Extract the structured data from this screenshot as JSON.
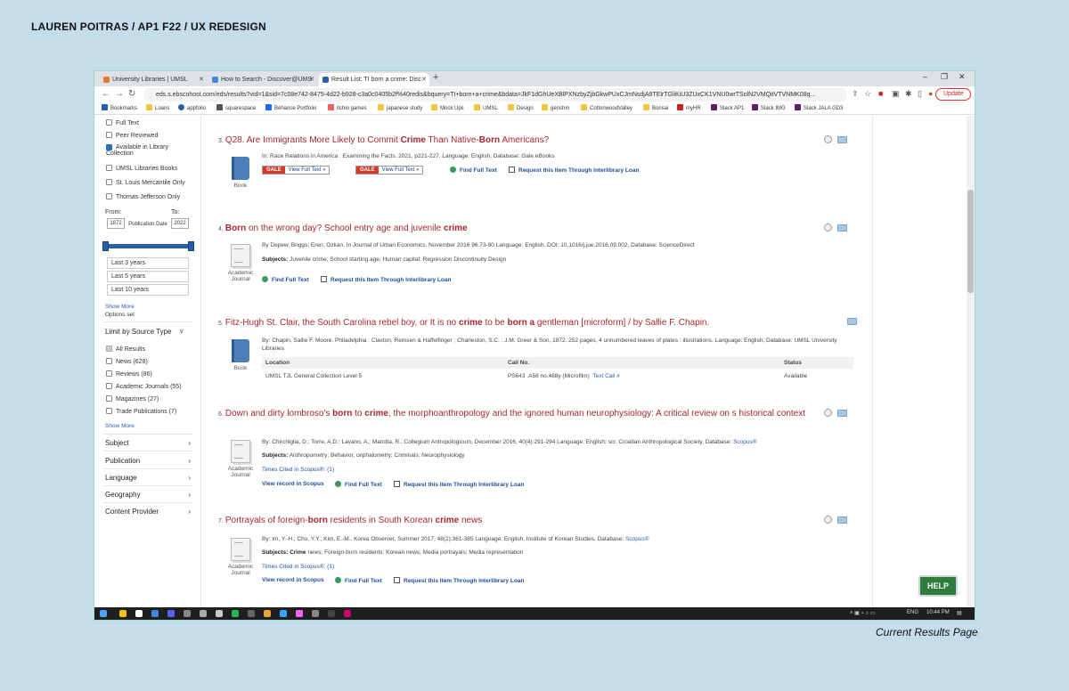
{
  "page": {
    "heading": "LAUREN POITRAS / AP1 F22 / UX REDESIGN",
    "caption": "Current Results Page"
  },
  "browser": {
    "tabs": [
      {
        "label": "University Libraries | UMSL",
        "color": "#e47b2a"
      },
      {
        "label": "How to Search - Discover@UMS",
        "color": "#3b8ad8"
      },
      {
        "label": "Result List: TI born a crime: Disc",
        "color": "#2a5fa8"
      }
    ],
    "url": "eds.s.ebscohost.com/eds/results?vid=1&sid=7c08e742-8475-4d22-b928-c3a0c0405b2f%40redis&bquery=TI+born+a+crime&bdata=JkF1dGhUeXBlPXNzbyZjbGkwPUxCJmNsdjA9TElrTGliKiU3ZUxCK1VNU0wrTSolN2VMQitVTVNMK08q...",
    "update_label": "Update",
    "bookmarks": [
      "Bookmarks",
      "Loans",
      "appfolio",
      "squarespace",
      "Behance Portfolio",
      "itchio games",
      "japanese study",
      "Mock Ups",
      "UMSL",
      "Design",
      "genshin",
      "CottonwoodValley",
      "Bonsai",
      "myHR",
      "Slack AP1",
      "Slack IMG",
      "Slack JALA GD3"
    ]
  },
  "sidebar": {
    "checkboxes": [
      {
        "label": "Full Text",
        "checked": false
      },
      {
        "label": "Peer Reviewed",
        "checked": false
      },
      {
        "label": "Available in Library Collection",
        "checked": true
      },
      {
        "label": "UMSL Libraries Books",
        "checked": false
      },
      {
        "label": "St. Louis Mercantile Only",
        "checked": false
      },
      {
        "label": "Thomas Jefferson Only",
        "checked": false
      }
    ],
    "date": {
      "from_label": "From:",
      "to_label": "To:",
      "from": "1872",
      "to": "2022",
      "label": "Publication Date"
    },
    "ranges": [
      "Last 3 years",
      "Last 5 years",
      "Last 10 years"
    ],
    "show_more": "Show More",
    "options_set": "Options set",
    "source_heading": "Limit by Source Type",
    "sources": [
      {
        "label": "All Results"
      },
      {
        "label": "News (628)"
      },
      {
        "label": "Reviews (86)"
      },
      {
        "label": "Academic Journals (55)"
      },
      {
        "label": "Magazines (27)"
      },
      {
        "label": "Trade Publications (7)"
      }
    ],
    "show_more2": "Show More",
    "sections": [
      "Subject",
      "Publication",
      "Language",
      "Geography",
      "Content Provider"
    ]
  },
  "results": [
    {
      "num": "3.",
      "title_parts": [
        "Q28. Are Immigrants More Likely to Commit ",
        "Crime",
        " Than Native-",
        "Born",
        " Americans?"
      ],
      "meta": "In: Race Relations in America : Examining the Facts. 2021, p221-227. Language: English, Database: Gale eBooks",
      "type": "Book",
      "gale_label": "GALE",
      "gale_view": "View Full Text »",
      "find": "Find Full Text",
      "request": "Request this Item Through Interlibrary Loan"
    },
    {
      "num": "4.",
      "title_parts": [
        "Born",
        " on the wrong day? School entry age and juvenile ",
        "crime"
      ],
      "meta": "By Depew, Briggs; Eren, Ozkan. In Journal of Urban Economics. November 2016 96:73-90 Language: English. DOI: 10.1016/j.jue.2016.09.002, Database: ScienceDirect",
      "subjects_label": "Subjects:",
      "subjects": "Juvenile crime; School starting age; Human capital; Regression Discontinuity Design",
      "type": "Academic Journal",
      "find": "Find Full Text",
      "request": "Request this Item Through Interlibrary Loan"
    },
    {
      "num": "5.",
      "title_parts": [
        "Fitz-Hugh St. Clair, the South Carolina rebel boy, or It is no ",
        "crime",
        " to be ",
        "born a",
        " gentleman [microform] / by Sallie F. Chapin."
      ],
      "meta": "By: Chapin, Sallie F. Moore. Philadelphia : Claxton, Remsen & Haffelfinger ; Charleston, S.C. : J.M. Greer & Son, 1872. 252 pages, 4 unnumbered leaves of plates : illustrations. Language: English, Database: UMSL University Libraries",
      "type": "Book",
      "holdings_headers": [
        "Location",
        "Call No.",
        "Status"
      ],
      "holding": {
        "location": "UMSL TJL General Collection Level 5",
        "callno": "PS643 .A56 no.488y (Microfilm)",
        "text_call": "Text Call #",
        "status": "Available"
      }
    },
    {
      "num": "6.",
      "title_parts": [
        "Down and dirty lombroso's ",
        "born",
        " to ",
        "crime",
        ", the morphoanthropology and the ignored human neurophysiology: A critical review on s historical context"
      ],
      "meta": "By: Chirchiglia, D.; Torre, A.D.; Lavano, A.; Marotta, R.. Collegium Antropologicum, December 2016, 40(4):291-294 Language: English; scr. Croatian Anthropological Society, Database:",
      "meta_link": "Scopus®",
      "subjects_label": "Subjects:",
      "subjects": "Anthropometry; Behavior, cephalometry; Criminals; Neurophysiology",
      "cited": "Times Cited in Scopus®: (1)",
      "view": "View record in Scopus",
      "type": "Academic Journal",
      "find": "Find Full Text",
      "request": "Request this Item Through Interlibrary Loan"
    },
    {
      "num": "7.",
      "title_parts": [
        "Portrayals of foreign-",
        "born",
        " residents in South Korean ",
        "crime",
        " news"
      ],
      "meta": "By: Im, Y.-H.; Cho, Y.Y.; Kim, E.-M.. Korea Observer, Summer 2017, 48(2):361-385 Language: English. Institute of Korean Studies, Database:",
      "meta_link": "Scopus®",
      "subjects_label": "Subjects:",
      "subjects_bold": "Crime",
      "subjects": " news; Foreign-born residents; Korean news; Media portrayals; Media representation",
      "cited": "Times Cited in Scopus®: (1)",
      "view": "View record in Scopus",
      "type": "Academic Journal",
      "find": "Find Full Text",
      "request": "Request this Item Through Interlibrary Loan"
    }
  ],
  "help_label": "HELP",
  "taskbar": {
    "lang": "ENG",
    "time": "10:44 PM"
  },
  "colors": {
    "accent": "#a8272c",
    "link": "#1a4e9a",
    "background": "#c5dcea"
  }
}
